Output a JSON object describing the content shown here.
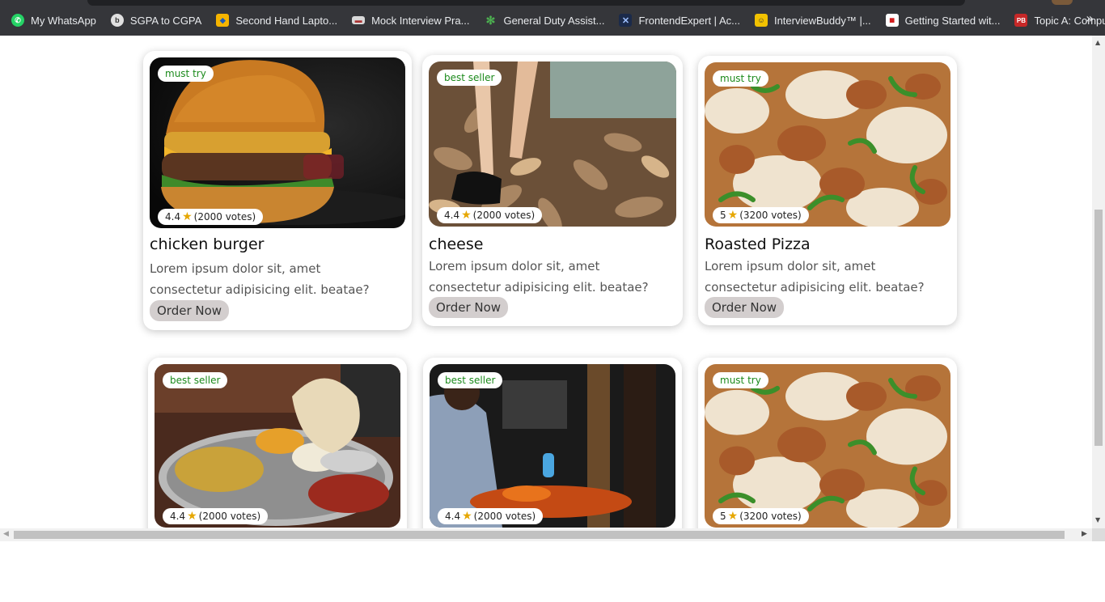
{
  "bookmarks": [
    {
      "label": "My WhatsApp",
      "icon": "whatsapp-icon",
      "color": "#25d366"
    },
    {
      "label": "SGPA to CGPA",
      "icon": "bing-icon",
      "color": "#e0e0e0"
    },
    {
      "label": "Second Hand Lapto...",
      "icon": "box-icon",
      "color": "#f5b400"
    },
    {
      "label": "Mock Interview Pra...",
      "icon": "laptop-icon",
      "color": "#d9d9d9"
    },
    {
      "label": "General Duty Assist...",
      "icon": "pinwheel-icon",
      "color": "#4caf50"
    },
    {
      "label": "FrontendExpert | Ac...",
      "icon": "fe-icon",
      "color": "#1b2a4a"
    },
    {
      "label": "InterviewBuddy™ |...",
      "icon": "person-icon",
      "color": "#f2c200"
    },
    {
      "label": "Getting Started wit...",
      "icon": "cisco-icon",
      "color": "#ffffff"
    },
    {
      "label": "Topic A: Computer...",
      "icon": "pb-icon",
      "color": "#c62828"
    }
  ],
  "bookmarks_more": "»",
  "cards": [
    {
      "tag": "must try",
      "rating": "4.4",
      "votes": "(2000 votes)",
      "title": "chicken burger",
      "description": "Lorem ipsum dolor sit, amet consectetur adipisicing elit. beatae?",
      "button": "Order Now",
      "image": "burger-photo"
    },
    {
      "tag": "best seller",
      "rating": "4.4",
      "votes": "(2000 votes)",
      "title": "cheese",
      "description": "Lorem ipsum dolor sit, amet consectetur adipisicing elit. beatae?",
      "button": "Order Now",
      "image": "autumn-leaves-photo"
    },
    {
      "tag": "must try",
      "rating": "5",
      "votes": "(3200 votes)",
      "title": "Roasted Pizza",
      "description": "Lorem ipsum dolor sit, amet consectetur adipisicing elit. beatae?",
      "button": "Order Now",
      "image": "pizza-photo"
    },
    {
      "tag": "best seller",
      "rating": "4.4",
      "votes": "(2000 votes)",
      "image": "thali-photo"
    },
    {
      "tag": "best seller",
      "rating": "4.4",
      "votes": "(2000 votes)",
      "image": "chef-kitchen-photo"
    },
    {
      "tag": "must try",
      "rating": "5",
      "votes": "(3200 votes)",
      "image": "pizza-photo"
    }
  ],
  "colors": {
    "tag_text": "#1b8a1b",
    "button_bg": "#d3cece",
    "star": "#e6a700",
    "toolbar": "#35363a"
  }
}
